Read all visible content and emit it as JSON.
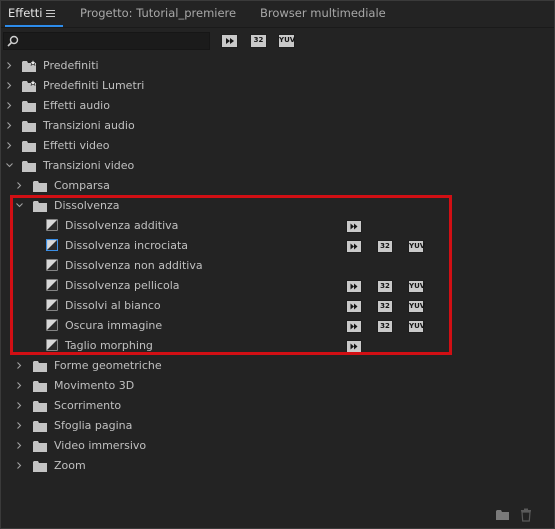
{
  "tabs": [
    {
      "label": "Effetti",
      "active": true
    },
    {
      "label": "Progetto: Tutorial_premiere",
      "active": false
    },
    {
      "label": "Browser multimediale",
      "active": false
    }
  ],
  "search": {
    "value": "",
    "placeholder": ""
  },
  "filters": [
    {
      "icon": "accelerated-effects-icon",
      "label": ""
    },
    {
      "icon": "32-bit-color-icon",
      "label": "32"
    },
    {
      "icon": "yuv-effects-icon",
      "label": "YUV"
    }
  ],
  "tree": {
    "root_items": [
      {
        "label": "Predefiniti",
        "icon": "folder-star-icon",
        "expanded": false
      },
      {
        "label": "Predefiniti Lumetri",
        "icon": "folder-star-icon",
        "expanded": false
      },
      {
        "label": "Effetti audio",
        "icon": "folder-icon",
        "expanded": false
      },
      {
        "label": "Transizioni audio",
        "icon": "folder-icon",
        "expanded": false
      },
      {
        "label": "Effetti video",
        "icon": "folder-icon",
        "expanded": false
      },
      {
        "label": "Transizioni video",
        "icon": "folder-icon",
        "expanded": true
      }
    ],
    "sub_before": {
      "label": "Comparsa",
      "expanded": false
    },
    "dissolve": {
      "label": "Dissolvenza",
      "expanded": true,
      "effects": [
        {
          "label": "Dissolvenza additiva",
          "accelerated": true,
          "bit32": false,
          "yuv": false
        },
        {
          "label": "Dissolvenza incrociata",
          "accelerated": true,
          "bit32": true,
          "yuv": true,
          "default": true
        },
        {
          "label": "Dissolvenza non additiva",
          "accelerated": false,
          "bit32": false,
          "yuv": false
        },
        {
          "label": "Dissolvenza pellicola",
          "accelerated": true,
          "bit32": true,
          "yuv": true
        },
        {
          "label": "Dissolvi al bianco",
          "accelerated": true,
          "bit32": true,
          "yuv": true
        },
        {
          "label": "Oscura immagine",
          "accelerated": true,
          "bit32": true,
          "yuv": true
        },
        {
          "label": "Taglio morphing",
          "accelerated": true,
          "bit32": false,
          "yuv": false
        }
      ]
    },
    "sub_after": [
      {
        "label": "Forme geometriche"
      },
      {
        "label": "Movimento 3D"
      },
      {
        "label": "Scorrimento"
      },
      {
        "label": "Sfoglia pagina"
      },
      {
        "label": "Video immersivo"
      },
      {
        "label": "Zoom"
      }
    ]
  },
  "badges": {
    "bit32": "32",
    "yuv": "YUV"
  },
  "bottom_bar": [
    {
      "icon": "new-folder-icon"
    },
    {
      "icon": "trash-icon"
    }
  ],
  "colors": {
    "accent": "#2d8ceb",
    "highlight": "#d10f14",
    "background": "#232323"
  }
}
